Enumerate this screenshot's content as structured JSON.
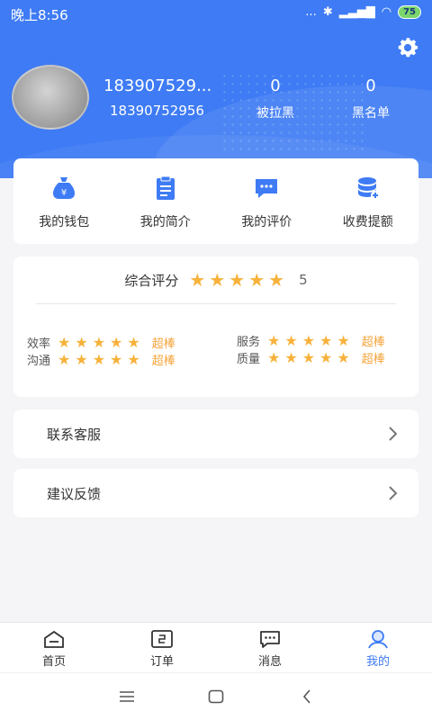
{
  "status_bar": {
    "time": "晚上8:56",
    "signal": "...",
    "battery": "75"
  },
  "profile": {
    "name": "183907529...",
    "phone": "18390752956",
    "stats": [
      {
        "value": "0",
        "label": "被拉黑"
      },
      {
        "value": "0",
        "label": "黑名单"
      }
    ]
  },
  "menu": [
    {
      "label": "我的钱包",
      "icon": "wallet-icon"
    },
    {
      "label": "我的简介",
      "icon": "profile-doc-icon"
    },
    {
      "label": "我的评价",
      "icon": "comment-icon"
    },
    {
      "label": "收费提额",
      "icon": "coins-add-icon"
    }
  ],
  "rating": {
    "title": "综合评分",
    "score": "5",
    "items": [
      {
        "label": "效率",
        "value": "超棒"
      },
      {
        "label": "沟通",
        "value": "超棒"
      },
      {
        "label": "服务",
        "value": "超棒"
      },
      {
        "label": "质量",
        "value": "超棒"
      }
    ]
  },
  "links": [
    {
      "label": "联系客服"
    },
    {
      "label": "建议反馈"
    }
  ],
  "tabs": [
    {
      "label": "首页",
      "icon": "home-icon"
    },
    {
      "label": "订单",
      "icon": "order-icon"
    },
    {
      "label": "消息",
      "icon": "message-icon"
    },
    {
      "label": "我的",
      "icon": "user-icon",
      "active": true
    }
  ],
  "colors": {
    "primary": "#3e7bf4",
    "star": "#f7b23b",
    "rating_text": "#f4a43a"
  }
}
